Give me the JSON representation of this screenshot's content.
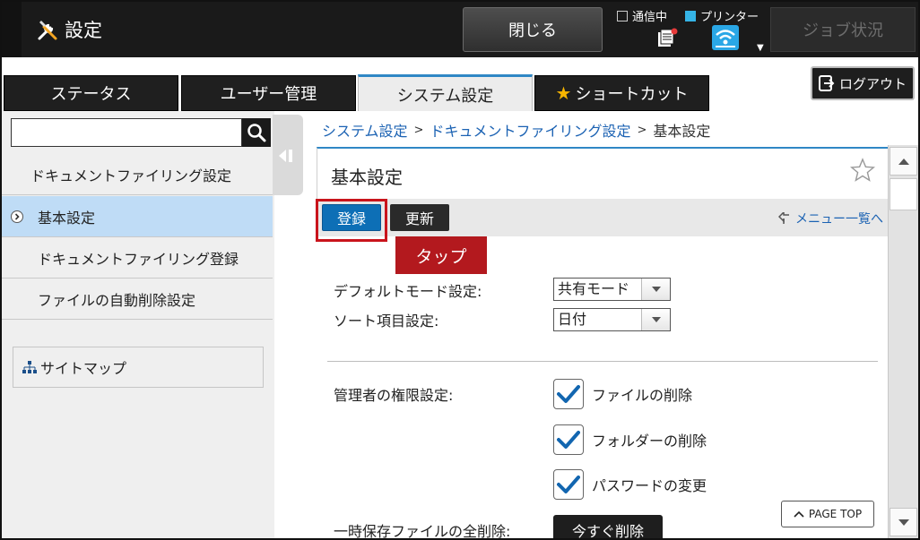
{
  "header": {
    "app_title": "設定",
    "close_label": "閉じる",
    "comm_label": "通信中",
    "printer_label": "プリンター",
    "job_status_label": "ジョブ状況"
  },
  "tabs": [
    {
      "label": "ステータス",
      "active": false
    },
    {
      "label": "ユーザー管理",
      "active": false
    },
    {
      "label": "システム設定",
      "active": true
    },
    {
      "label": "ショートカット",
      "active": false
    }
  ],
  "logout_label": "ログアウト",
  "sidebar": {
    "search": {
      "value": "",
      "placeholder": ""
    },
    "items": [
      {
        "label": "ドキュメントファイリング設定"
      },
      {
        "label": "基本設定",
        "active": true
      },
      {
        "label": "ドキュメントファイリング登録"
      },
      {
        "label": "ファイルの自動削除設定"
      }
    ],
    "sitemap_label": "サイトマップ"
  },
  "breadcrumb": [
    {
      "label": "システム設定",
      "link": true
    },
    {
      "label": "ドキュメントファイリング設定",
      "link": true
    },
    {
      "label": "基本設定",
      "link": false
    }
  ],
  "breadcrumb_sep": ">",
  "panel": {
    "title": "基本設定",
    "register_label": "登録",
    "refresh_label": "更新",
    "menu_link_label": "メニュー一覧へ",
    "tap_annotation": "タップ"
  },
  "form": {
    "default_mode": {
      "label": "デフォルトモード設定:",
      "value": "共有モード"
    },
    "sort_item": {
      "label": "ソート項目設定:",
      "value": "日付"
    },
    "admin_permissions": {
      "label": "管理者の権限設定:",
      "options": [
        {
          "label": "ファイルの削除",
          "checked": true
        },
        {
          "label": "フォルダーの削除",
          "checked": true
        },
        {
          "label": "パスワードの変更",
          "checked": true
        }
      ]
    },
    "temp_delete": {
      "label": "一時保存ファイルの全削除:",
      "button_label": "今すぐ削除"
    }
  },
  "page_top_label": "PAGE TOP",
  "colors": {
    "accent_blue": "#2f87c5",
    "register_blue": "#0d6fb6",
    "tap_red": "#b3191e",
    "active_sidebar": "#bfdcf6",
    "link_blue": "#1b62b3"
  }
}
